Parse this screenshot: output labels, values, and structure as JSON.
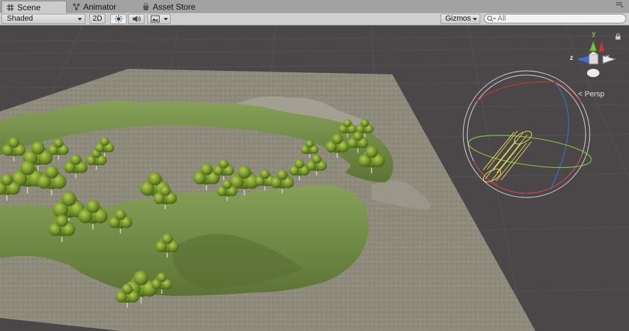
{
  "tabs": [
    {
      "label": "Scene",
      "icon": "grid-icon",
      "active": true
    },
    {
      "label": "Animator",
      "icon": "animator-icon",
      "active": false
    },
    {
      "label": "Asset Store",
      "icon": "store-icon",
      "active": false
    }
  ],
  "toolbar": {
    "draw_mode": "Shaded",
    "mode_2d": "2D",
    "gizmos_label": "Gizmos",
    "search_placeholder": "All"
  },
  "scene": {
    "projection_label": "Persp",
    "axes": {
      "y": "y",
      "z": "z",
      "x": "x"
    },
    "colors": {
      "sky": "#4b4647",
      "ground": "#8d8a7b",
      "hill": "#6f8748",
      "tree": "#6c8c2a",
      "axis_x": "#d43a2a",
      "axis_y": "#7dc33a",
      "axis_z": "#3a6fd4"
    }
  }
}
